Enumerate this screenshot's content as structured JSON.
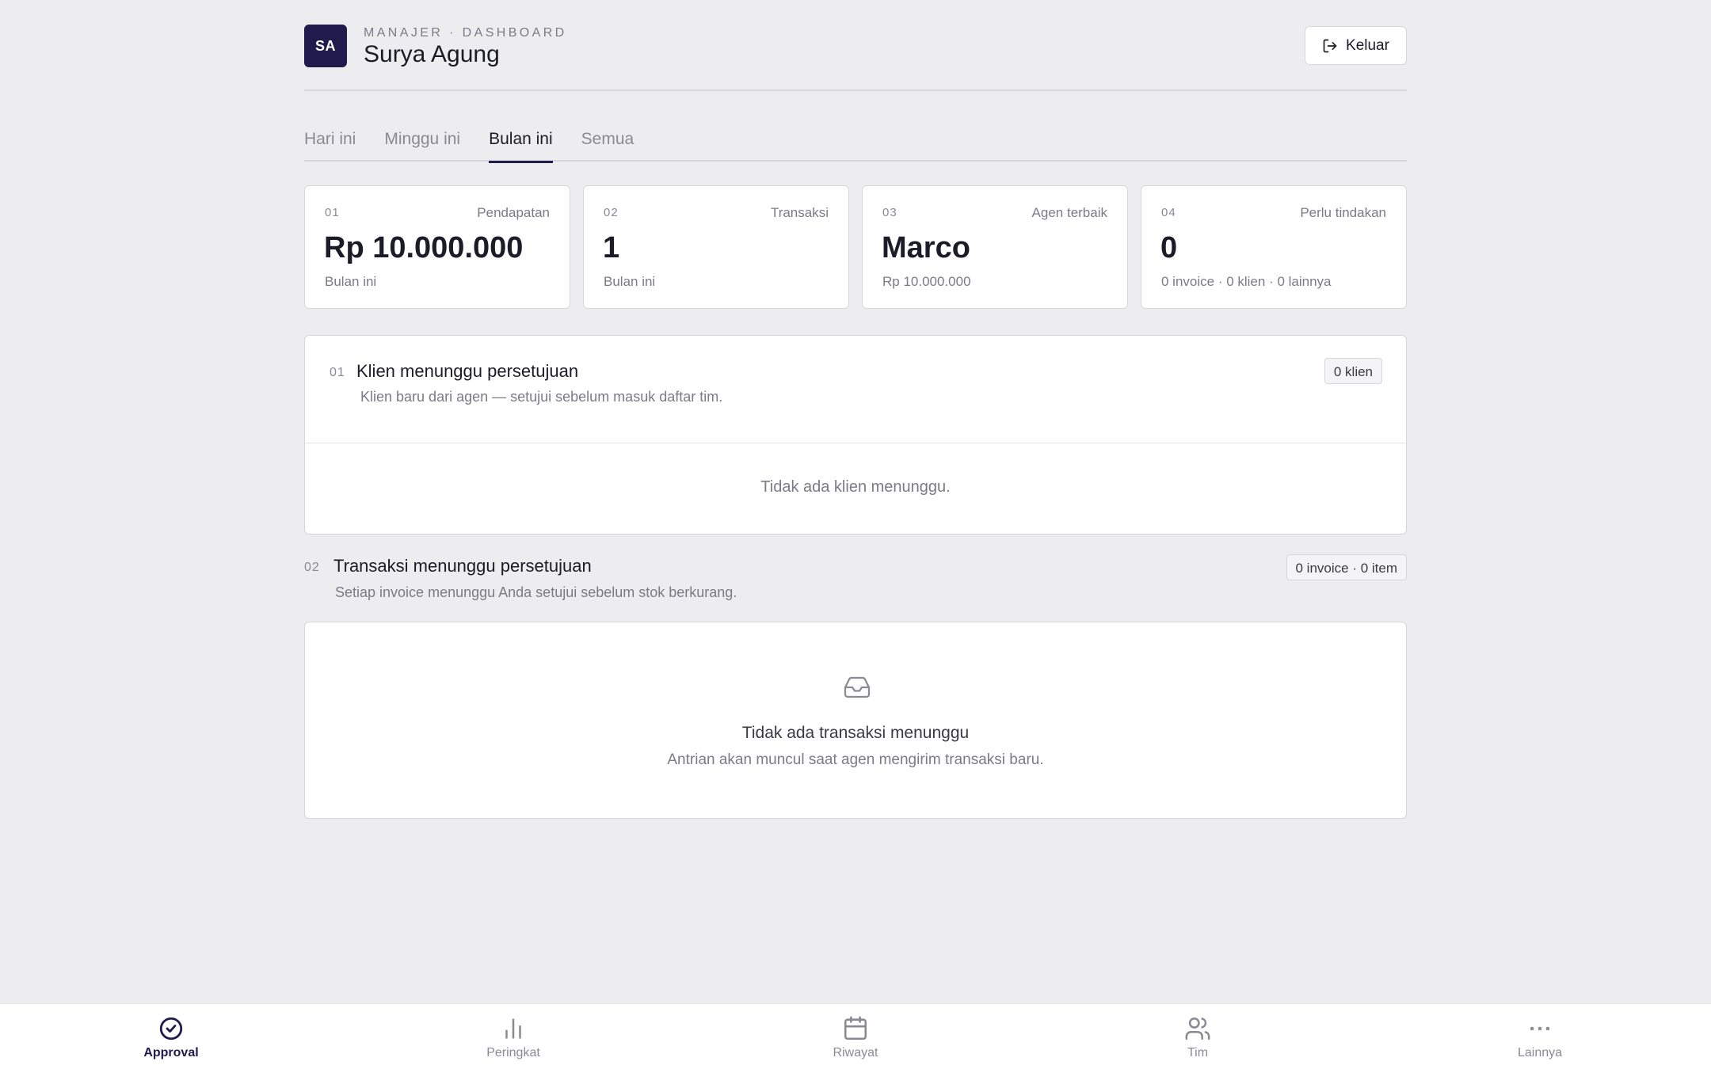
{
  "header": {
    "avatar_initials": "SA",
    "role": "MANAJER · DASHBOARD",
    "user_name": "Surya Agung",
    "logout_label": "Keluar"
  },
  "tabs": [
    {
      "label": "Hari ini",
      "active": false
    },
    {
      "label": "Minggu ini",
      "active": false
    },
    {
      "label": "Bulan ini",
      "active": true
    },
    {
      "label": "Semua",
      "active": false
    }
  ],
  "stats": [
    {
      "num": "01",
      "label": "Pendapatan",
      "value": "Rp 10.000.000",
      "sub": "Bulan ini"
    },
    {
      "num": "02",
      "label": "Transaksi",
      "value": "1",
      "sub": "Bulan ini"
    },
    {
      "num": "03",
      "label": "Agen terbaik",
      "value": "Marco",
      "sub": "Rp 10.000.000"
    },
    {
      "num": "04",
      "label": "Perlu tindakan",
      "value": "0",
      "sub": "0 invoice · 0 klien · 0 lainnya"
    }
  ],
  "clients_section": {
    "num": "01",
    "title": "Klien menunggu persetujuan",
    "description": "Klien baru dari agen — setujui sebelum masuk daftar tim.",
    "badge": "0 klien",
    "empty_text": "Tidak ada klien menunggu."
  },
  "transactions_section": {
    "num": "02",
    "title": "Transaksi menunggu persetujuan",
    "description": "Setiap invoice menunggu Anda setujui sebelum stok berkurang.",
    "badge": "0 invoice · 0 item",
    "empty_icon": "inbox-icon",
    "empty_title": "Tidak ada transaksi menunggu",
    "empty_sub": "Antrian akan muncul saat agen mengirim transaksi baru."
  },
  "bottom_nav": [
    {
      "label": "Approval",
      "icon": "check-circle-icon",
      "active": true
    },
    {
      "label": "Peringkat",
      "icon": "bar-chart-icon",
      "active": false
    },
    {
      "label": "Riwayat",
      "icon": "calendar-icon",
      "active": false
    },
    {
      "label": "Tim",
      "icon": "users-icon",
      "active": false
    },
    {
      "label": "Lainnya",
      "icon": "more-icon",
      "active": false
    }
  ],
  "colors": {
    "accent": "#1f1b4d",
    "background": "#ededf0",
    "card": "#ffffff",
    "border": "#d6d6dc",
    "muted_text": "#7b7b86"
  }
}
